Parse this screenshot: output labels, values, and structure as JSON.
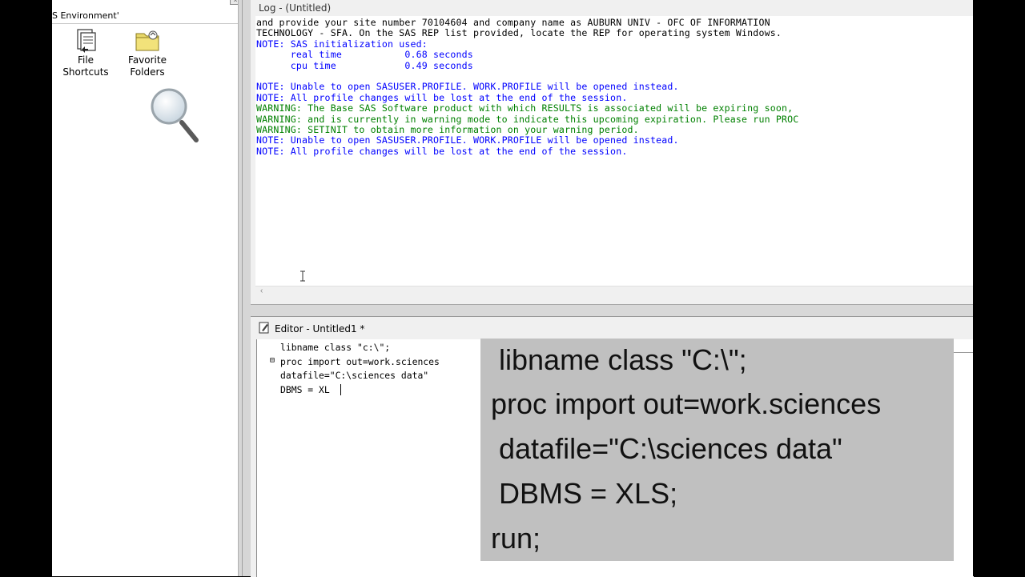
{
  "explorer": {
    "title": "S Environment'",
    "close_label": "x",
    "items": [
      {
        "label_line1": "File Shortcuts",
        "label_line2": "",
        "icon": "file-shortcuts-icon"
      },
      {
        "label_line1": "Favorite",
        "label_line2": "Folders",
        "icon": "favorite-folders-icon"
      }
    ],
    "search_icon": "magnifier-icon"
  },
  "log": {
    "title": "Log - (Untitled)",
    "lines": [
      {
        "text": "and provide your site number 70104604 and company name as AUBURN UNIV - OFC OF INFORMATION",
        "color": "black"
      },
      {
        "text": "TECHNOLOGY - SFA. On the SAS REP list provided, locate the REP for operating system Windows.",
        "color": "black"
      },
      {
        "text": "NOTE: SAS initialization used:",
        "color": "blue"
      },
      {
        "text": "      real time           0.68 seconds",
        "color": "blue"
      },
      {
        "text": "      cpu time            0.49 seconds",
        "color": "blue"
      },
      {
        "text": "",
        "color": "blue"
      },
      {
        "text": "NOTE: Unable to open SASUSER.PROFILE. WORK.PROFILE will be opened instead.",
        "color": "blue"
      },
      {
        "text": "NOTE: All profile changes will be lost at the end of the session.",
        "color": "blue"
      },
      {
        "text": "WARNING: The Base SAS Software product with which RESULTS is associated will be expiring soon,",
        "color": "green"
      },
      {
        "text": "WARNING: and is currently in warning mode to indicate this upcoming expiration. Please run PROC",
        "color": "green"
      },
      {
        "text": "WARNING: SETINIT to obtain more information on your warning period.",
        "color": "green"
      },
      {
        "text": "NOTE: Unable to open SASUSER.PROFILE. WORK.PROFILE will be opened instead.",
        "color": "blue"
      },
      {
        "text": "NOTE: All profile changes will be lost at the end of the session.",
        "color": "blue"
      }
    ],
    "scroll_left": "‹"
  },
  "editor": {
    "title": "Editor - Untitled1 *",
    "lines": [
      "libname class \"c:\\\";",
      "proc import out=work.sciences",
      "datafile=\"C:\\sciences data\"",
      "DBMS = XL"
    ],
    "fold_marker": "⊟"
  },
  "caption": {
    "lines": [
      " libname class \"C:\\\";",
      "proc import out=work.sciences",
      " datafile=\"C:\\sciences data\"",
      " DBMS = XLS;",
      "run;"
    ]
  },
  "colors": {
    "blue": "#0000ff",
    "green": "#008000",
    "black": "#000000"
  }
}
